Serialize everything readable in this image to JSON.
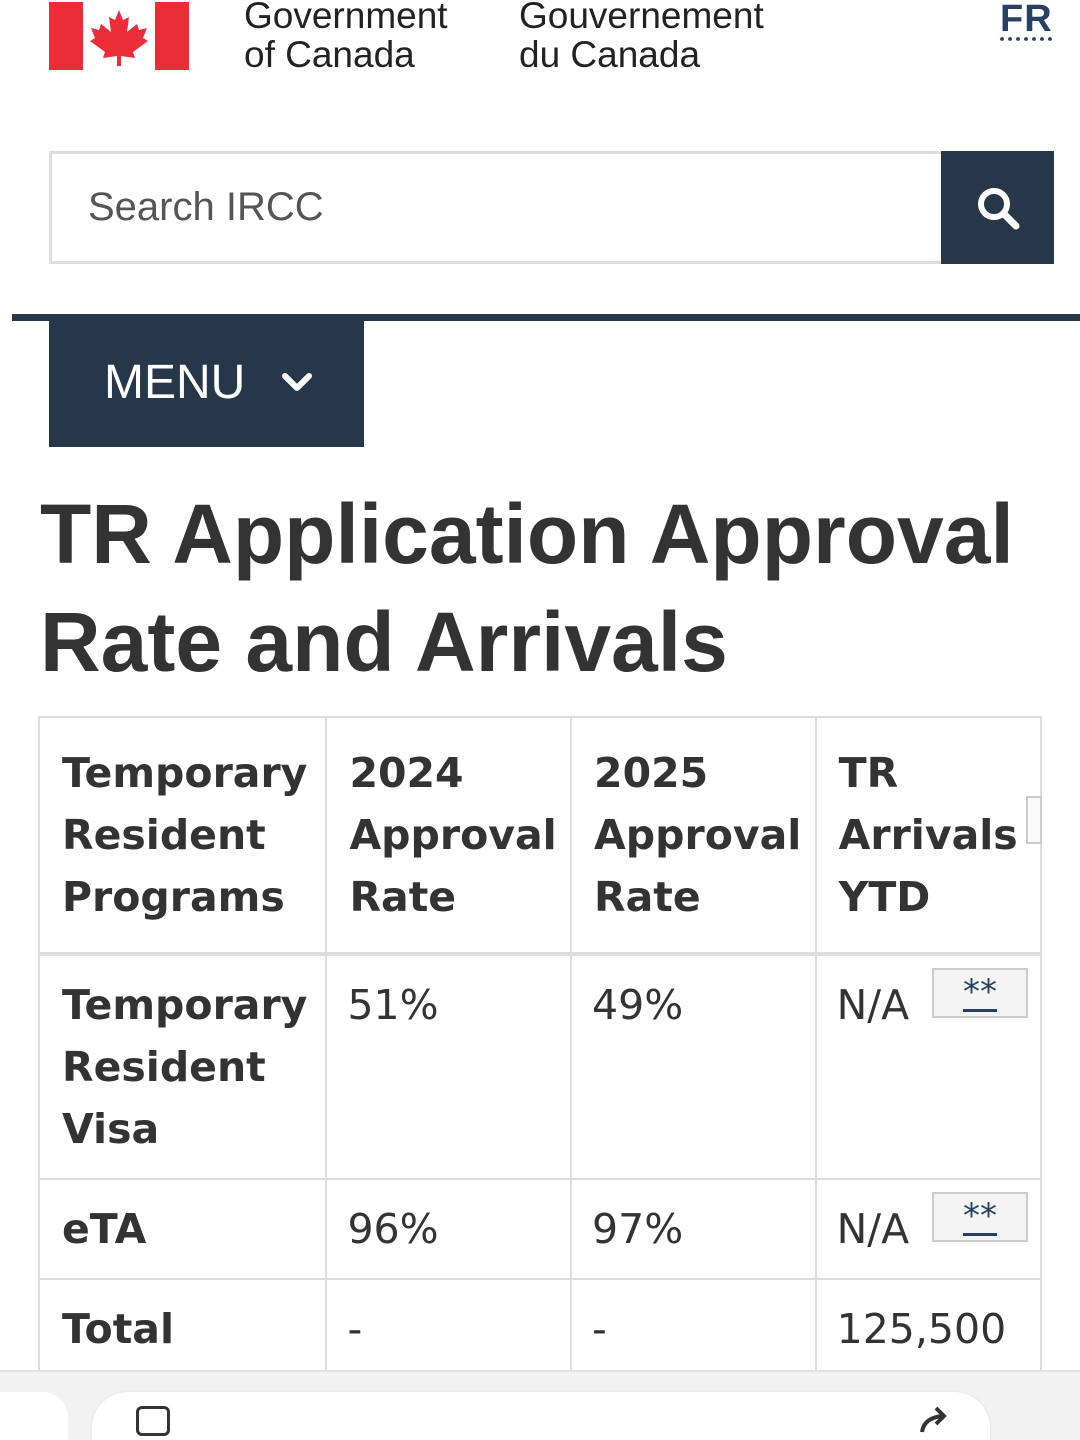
{
  "header": {
    "gov_en_line1": "Government",
    "gov_en_line2": "of Canada",
    "gov_fr_line1": "Gouvernement",
    "gov_fr_line2": "du Canada",
    "lang_toggle": "FR"
  },
  "search": {
    "placeholder": "Search IRCC",
    "icon": "search-icon"
  },
  "menu": {
    "label": "MENU",
    "icon": "chevron-down-icon"
  },
  "page": {
    "title": "TR Application Approval Rate and Arrivals"
  },
  "table": {
    "headers": [
      "Temporary Resident Programs",
      "2024 Approval Rate",
      "2025 Approval Rate",
      "TR Arrivals YTD"
    ],
    "rows": [
      {
        "program": "Temporary Resident Visa",
        "rate_2024": "51%",
        "rate_2025": "49%",
        "arrivals": "N/A",
        "note": "**"
      },
      {
        "program": "eTA",
        "rate_2024": "96%",
        "rate_2025": "97%",
        "arrivals": "N/A",
        "note": "**"
      },
      {
        "program": "Total",
        "rate_2024": "-",
        "rate_2025": "-",
        "arrivals": "125,500"
      }
    ]
  },
  "colors": {
    "brand_navy": "#26374a",
    "link_blue": "#284162",
    "flag_red": "#eb2d37",
    "text": "#333333",
    "border": "#dddddd"
  }
}
